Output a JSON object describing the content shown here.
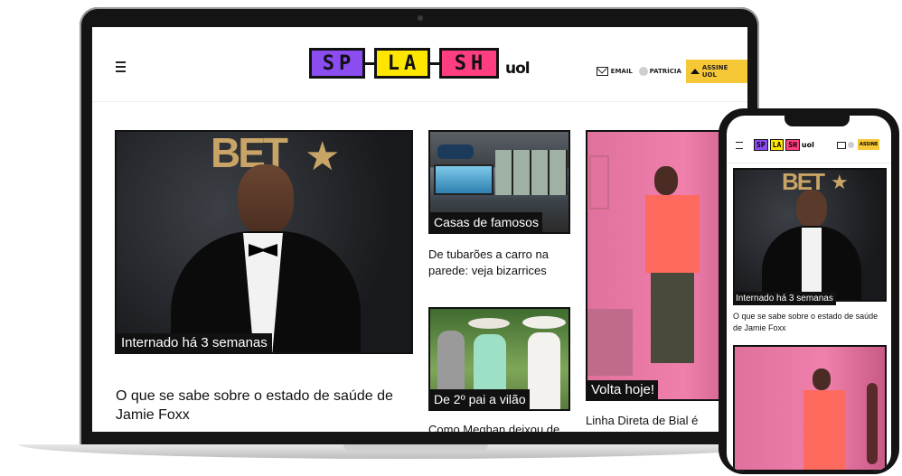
{
  "site": {
    "logo_letters": [
      "SP",
      "LA",
      "SH"
    ],
    "logo_suffix": "uol",
    "colors": {
      "sp": "#8b4cf0",
      "la": "#ffe600",
      "sh": "#ff3e82",
      "accent": "#f6c736"
    }
  },
  "header": {
    "menu_icon": "hamburger-icon",
    "email_label": "EMAIL",
    "user_label": "PATRÍCIA",
    "subscribe_label": "ASSINE UOL",
    "subscribe_label_mobile": "ASSINE"
  },
  "articles": [
    {
      "tag": "Internado há 3 semanas",
      "headline": "O que se sabe sobre o estado de saúde de Jamie Foxx",
      "banner": "BET"
    },
    {
      "tag": "Casas de famosos",
      "headline": "De tubarões a carro na parede: veja bizarrices"
    },
    {
      "tag": "De 2º pai a vilão",
      "headline": "Como Meghan deixou de"
    },
    {
      "tag": "Volta hoje!",
      "headline": "Linha Direta de Bial é"
    }
  ]
}
